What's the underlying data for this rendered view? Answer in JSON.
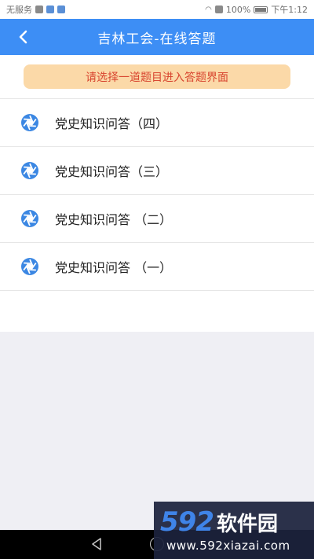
{
  "status_bar": {
    "carrier": "无服务",
    "battery": "100%",
    "time": "下午1:12"
  },
  "header": {
    "title": "吉林工会-在线答题"
  },
  "hint": {
    "text": "请选择一道题目进入答题界面"
  },
  "quiz_list": [
    {
      "label": "党史知识问答（四）",
      "icon": "aperture-icon"
    },
    {
      "label": "党史知识问答（三）",
      "icon": "aperture-icon"
    },
    {
      "label": "党史知识问答 （二）",
      "icon": "aperture-icon"
    },
    {
      "label": "党史知识问答 （一）",
      "icon": "aperture-icon"
    }
  ],
  "watermark": {
    "logo_number": "592",
    "logo_text": "软件园",
    "url": "www.592xiazai.com"
  },
  "colors": {
    "nav_blue": "#3d8ef5",
    "hint_bg": "#fbd9a8",
    "hint_text": "#d8452f",
    "icon_blue": "#3b87e3"
  }
}
